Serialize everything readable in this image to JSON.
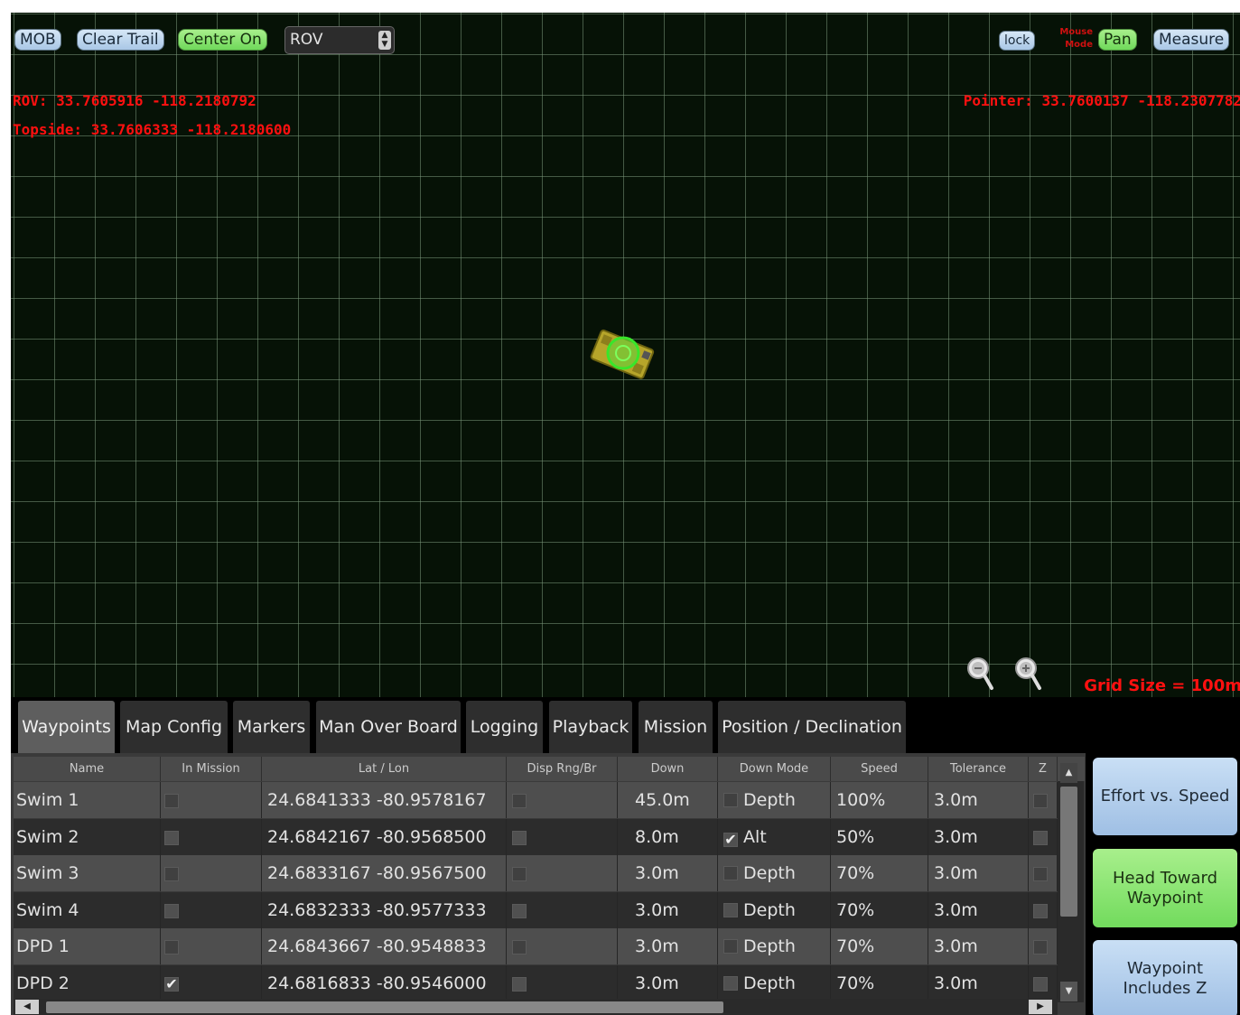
{
  "toolbar": {
    "mob": "MOB",
    "clear_trail": "Clear Trail",
    "center_on": "Center On",
    "center_target": "ROV",
    "lock": "lock",
    "mouse_mode_line1": "Mouse",
    "mouse_mode_line2": "Mode",
    "pan": "Pan",
    "measure": "Measure"
  },
  "map": {
    "rov_coords": "ROV: 33.7605916 -118.2180792",
    "topside_coords": "Topside: 33.7606333 -118.2180600",
    "pointer_coords": "Pointer: 33.7600137 -118.2307782",
    "grid_size": "Grid Size = 100m"
  },
  "tabs": [
    {
      "label": "Waypoints",
      "active": true
    },
    {
      "label": "Map Config"
    },
    {
      "label": "Markers"
    },
    {
      "label": "Man Over Board"
    },
    {
      "label": "Logging"
    },
    {
      "label": "Playback"
    },
    {
      "label": "Mission"
    },
    {
      "label": "Position / Declination"
    }
  ],
  "table": {
    "columns": [
      "Name",
      "In Mission",
      "Lat / Lon",
      "Disp Rng/Br",
      "Down",
      "Down Mode",
      "Speed",
      "Tolerance",
      "Z"
    ],
    "rows": [
      {
        "name": "Swim 1",
        "in_mission": false,
        "latlon": "24.6841333 -80.9578167",
        "disp": false,
        "down": "45.0m",
        "mode_checked": false,
        "mode": "Depth",
        "speed": "100%",
        "tolerance": "3.0m",
        "z": false
      },
      {
        "name": "Swim 2",
        "in_mission": false,
        "latlon": "24.6842167 -80.9568500",
        "disp": false,
        "down": "8.0m",
        "mode_checked": true,
        "mode": "Alt",
        "speed": "50%",
        "tolerance": "3.0m",
        "z": false
      },
      {
        "name": "Swim 3",
        "in_mission": false,
        "latlon": "24.6833167 -80.9567500",
        "disp": false,
        "down": "3.0m",
        "mode_checked": false,
        "mode": "Depth",
        "speed": "70%",
        "tolerance": "3.0m",
        "z": false
      },
      {
        "name": "Swim 4",
        "in_mission": false,
        "latlon": "24.6832333 -80.9577333",
        "disp": false,
        "down": "3.0m",
        "mode_checked": false,
        "mode": "Depth",
        "speed": "70%",
        "tolerance": "3.0m",
        "z": false
      },
      {
        "name": "DPD 1",
        "in_mission": false,
        "latlon": "24.6843667 -80.9548833",
        "disp": false,
        "down": "3.0m",
        "mode_checked": false,
        "mode": "Depth",
        "speed": "70%",
        "tolerance": "3.0m",
        "z": false
      },
      {
        "name": "DPD 2",
        "in_mission": true,
        "latlon": "24.6816833 -80.9546000",
        "disp": false,
        "down": "3.0m",
        "mode_checked": false,
        "mode": "Depth",
        "speed": "70%",
        "tolerance": "3.0m",
        "z": false
      }
    ]
  },
  "side_buttons": {
    "effort": "Effort vs. Speed",
    "head_toward_line1": "Head Toward",
    "head_toward_line2": "Waypoint",
    "includes_z_line1": "Waypoint",
    "includes_z_line2": "Includes Z"
  },
  "colors": {
    "grid_bg": "#061206",
    "coord_text": "#ff1010",
    "button_blue": "#b8d3ee",
    "button_green": "#8ae670"
  }
}
